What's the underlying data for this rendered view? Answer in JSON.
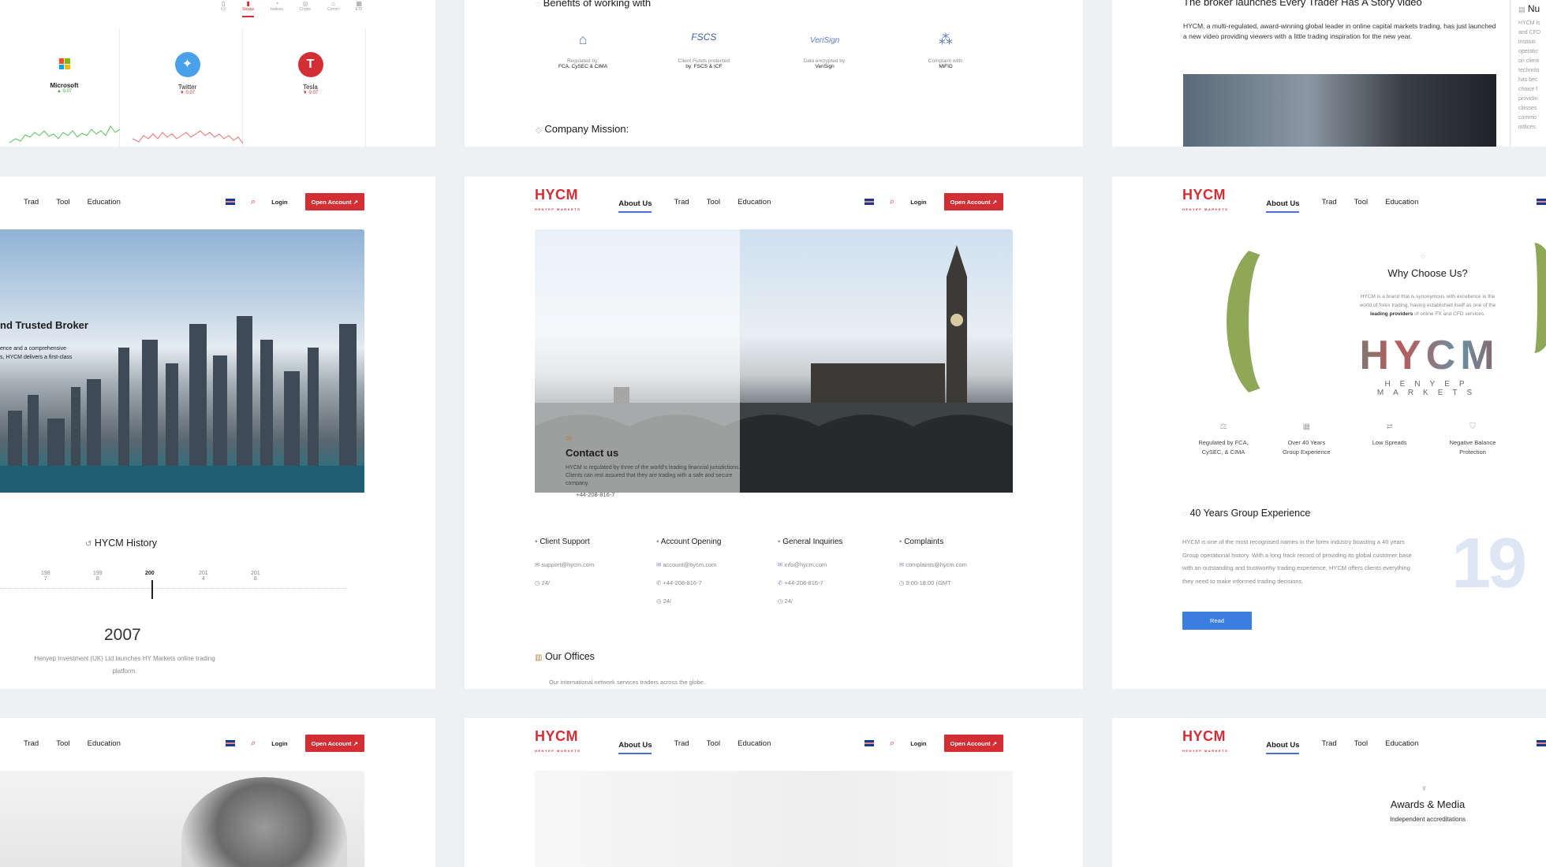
{
  "top_left": {
    "tabs": [
      "FX",
      "Stocks",
      "Indices",
      "Crypto",
      "Comm",
      "ETF"
    ],
    "stocks": [
      {
        "name": "Microsoft",
        "change": "▲ 0.07",
        "dir": "up"
      },
      {
        "name": "Twitter",
        "change": "▼ 0.07",
        "dir": "down"
      },
      {
        "name": "Tesla",
        "change": "▼ 0.07",
        "dir": "down"
      }
    ]
  },
  "top_mid": {
    "heading": "Benefits of working with",
    "benefits": [
      {
        "line1": "Regulated by:",
        "line2": "FCA, CySEC & CIMA"
      },
      {
        "line1": "Client Funds protected",
        "line2": "by: FSCS & ICF"
      },
      {
        "line1": "Data encrypted by:",
        "line2": "VeriSign"
      },
      {
        "line1": "Complaint with:",
        "line2": "MiFID"
      }
    ],
    "brands": [
      "FSCS",
      "VeriSign"
    ],
    "mission": "Company Mission:"
  },
  "top_right": {
    "headline": "The broker launches Every Trader Has A Story video",
    "body": "HYCM, a multi-regulated, award-winning global leader in online capital markets trading, has just launched a new video providing viewers with a little trading inspiration for the new year.",
    "side_title": "Nu",
    "side_lines": [
      "HYCM is",
      "and CFD",
      "instituti",
      "operatic",
      "on client",
      "technolo",
      "has bec",
      "choice f",
      "providin",
      "classes",
      "commo",
      "indices."
    ]
  },
  "nav": {
    "logo": "HYCM",
    "logo_sub": "HENYEP MARKETS",
    "about": "About Us",
    "trad": "Trad",
    "tool": "Tool",
    "education": "Education",
    "login": "Login",
    "open_account": "Open Account"
  },
  "mid_left": {
    "hero_title": "nd Trusted Broker",
    "hero_text_1": "ence and a comprehensive",
    "hero_text_2": "s, HYCM delivers a first-class",
    "history_title": "HYCM History",
    "years": [
      "198",
      "199",
      "200",
      "201",
      "201"
    ],
    "years_sub": [
      "7",
      "8",
      "",
      "4",
      "8"
    ],
    "active_year": "2007",
    "history_text": "Henyep Investment (UK) Ltd launches HY Markets online trading platform."
  },
  "mid_center": {
    "contact_title": "Contact us",
    "contact_text": "HYCM is regulated by three of the world's leading financial jurisdictions. Clients can rest assured that they are trading with a safe and secure company.",
    "contact_phone": "+44-208-816-7",
    "columns": [
      {
        "title": "Client Support",
        "lines": [
          {
            "icon": "mail-icon",
            "text": "support@hycm.com"
          },
          {
            "icon": "clock-icon",
            "text": "24/"
          }
        ]
      },
      {
        "title": "Account Opening",
        "lines": [
          {
            "icon": "mail-icon",
            "text": "account@hycm.com"
          },
          {
            "icon": "phone-icon",
            "text": "+44-208-816-7"
          },
          {
            "icon": "clock-icon",
            "text": "24/"
          }
        ]
      },
      {
        "title": "General Inquiries",
        "lines": [
          {
            "icon": "mail-icon",
            "text": "info@hycm.com"
          },
          {
            "icon": "phone-icon",
            "text": "+44-208-816-7"
          },
          {
            "icon": "clock-icon",
            "text": "24/"
          }
        ]
      },
      {
        "title": "Complaints",
        "lines": [
          {
            "icon": "mail-icon",
            "text": "complaints@hycm.com"
          },
          {
            "icon": "clock-icon",
            "text": "9:00-18:00 (GMT"
          }
        ]
      }
    ],
    "offices_title": "Our Offices",
    "offices_text": "Our international network services traders across the globe."
  },
  "mid_right": {
    "why_title": "Why Choose Us?",
    "why_text_1": "HYCM is a brand that is synonymous with excellence in the",
    "why_text_2": "world of forex trading, having established itself as one of the",
    "why_text_3a": "leading providers",
    "why_text_3b": " of online FX and CFD services.",
    "big_logo": "HYCM",
    "big_sub": "HENYEP MARKETS",
    "features": [
      {
        "l1": "Regulated by FCA,",
        "l2": "CySEC, & CIMA"
      },
      {
        "l1": "Over 40 Years",
        "l2": "Group Experience"
      },
      {
        "l1": "Low Spreads",
        "l2": ""
      },
      {
        "l1": "Negative Balance",
        "l2": "Protection"
      }
    ],
    "exp_title": "40 Years Group Experience",
    "exp_text": "HYCM is one of the most recognised names in the forex industry boasting a 40 years Group operational history. With a long track record of providing its global customer base with an outstanding and trustworthy trading experience, HYCM offers clients everything they need to make informed trading decisions.",
    "read_more": "Read",
    "big_year": "19"
  },
  "bottom_right": {
    "awards_title": "Awards & Media",
    "awards_sub": "Independent accreditations"
  },
  "colors": {
    "brand_red": "#d42e35",
    "read_blue": "#3b7ee0",
    "bg": "#eef1f4"
  }
}
